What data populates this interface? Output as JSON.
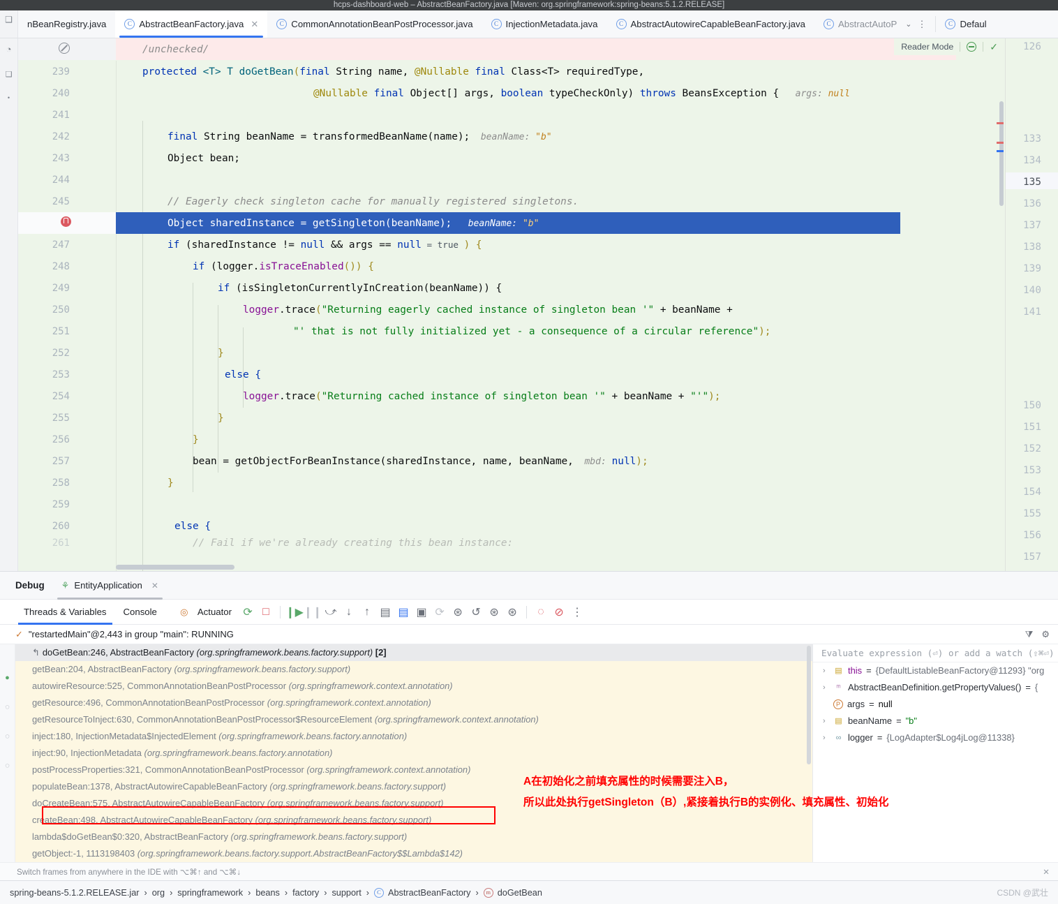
{
  "window": {
    "title": "hcps-dashboard-web – AbstractBeanFactory.java [Maven: org.springframework:spring-beans:5.1.2.RELEASE]"
  },
  "tabs": [
    {
      "label": "nBeanRegistry.java",
      "active": false,
      "icon": "class-icon"
    },
    {
      "label": "AbstractBeanFactory.java",
      "active": true,
      "icon": "class-icon"
    },
    {
      "label": "CommonAnnotationBeanPostProcessor.java",
      "active": false,
      "icon": "class-icon"
    },
    {
      "label": "InjectionMetadata.java",
      "active": false,
      "icon": "class-icon"
    },
    {
      "label": "AbstractAutowireCapableBeanFactory.java",
      "active": false,
      "icon": "class-icon"
    },
    {
      "label": "AbstractAutoP",
      "active": false,
      "icon": "class-icon"
    },
    {
      "label": "Defaul",
      "active": false,
      "icon": "class-icon"
    }
  ],
  "editor": {
    "reader_mode": "Reader Mode",
    "lines": [
      {
        "num": "",
        "gutter": "no-entry"
      },
      {
        "num": "239"
      },
      {
        "num": "240"
      },
      {
        "num": "241"
      },
      {
        "num": "242"
      },
      {
        "num": "243"
      },
      {
        "num": "244"
      },
      {
        "num": "245"
      },
      {
        "num": "246",
        "gutter": "breakpoint",
        "highlighted": true
      },
      {
        "num": "247"
      },
      {
        "num": "248"
      },
      {
        "num": "249"
      },
      {
        "num": "250"
      },
      {
        "num": "251"
      },
      {
        "num": "252"
      },
      {
        "num": "253"
      },
      {
        "num": "254"
      },
      {
        "num": "255"
      },
      {
        "num": "256"
      },
      {
        "num": "257"
      },
      {
        "num": "258"
      },
      {
        "num": "259"
      },
      {
        "num": "260"
      },
      {
        "num": "261"
      }
    ],
    "code": {
      "l238_unchecked": "/unchecked/",
      "l239_a": "protected ",
      "l239_b": "<T> T ",
      "l239_c": "doGetBean",
      "l239_d": "(",
      "l239_e": "final ",
      "l239_f": "String name, ",
      "l239_g": "@Nullable ",
      "l239_h": "final ",
      "l239_i": "Class<T> requiredType,",
      "l240_a": "@Nullable ",
      "l240_b": "final ",
      "l240_c": "Object[] args, ",
      "l240_d": "boolean ",
      "l240_e": "typeCheckOnly) ",
      "l240_f": "throws ",
      "l240_g": "BeansException {",
      "l240_hint": "args:",
      "l240_hintval": "null",
      "l242_a": "final ",
      "l242_b": "String beanName = transformedBeanName(name);",
      "l242_hint": "beanName:",
      "l242_hintval": "\"b\"",
      "l243": "Object bean;",
      "l245": "// Eagerly check singleton cache for manually registered singletons.",
      "l246": "Object sharedInstance = getSingleton(beanName);",
      "l246_hint": "beanName:",
      "l246_hintval": "\"b\"",
      "l247_a": "if ",
      "l247_b": "(sharedInstance != ",
      "l247_c": "null",
      "l247_d": " && args == ",
      "l247_e": "null",
      "l247_hint": "= true",
      "l247_f": ") {",
      "l248_a": "if ",
      "l248_b": "(logger.",
      "l248_c": "isTraceEnabled",
      "l248_d": "()) {",
      "l249_a": "if ",
      "l249_b": "(isSingletonCurrentlyInCreation(beanName)) {",
      "l250_a": "logger",
      "l250_b": ".trace",
      "l250_c": "(",
      "l250_d": "\"Returning eagerly cached instance of singleton bean '\"",
      "l250_e": " + beanName +",
      "l251_a": "\"' that is not fully initialized yet - a consequence of a circular reference\"",
      "l251_b": ");",
      "l252": "}",
      "l253": "else {",
      "l254_a": "logger",
      "l254_b": ".trace",
      "l254_c": "(",
      "l254_d": "\"Returning cached instance of singleton bean '\"",
      "l254_e": " + beanName + ",
      "l254_f": "\"'\"",
      "l254_g": ");",
      "l255": "}",
      "l256": "}",
      "l257_a": "bean = getObjectForBeanInstance(sharedInstance, name, beanName,",
      "l257_hint": "mbd:",
      "l257_hintval": "null",
      "l257_b": ");",
      "l258": "}",
      "l260": "else {",
      "l261": "// Fail if we're already creating this bean instance:"
    },
    "right_pane_lines": [
      "126",
      "133",
      "134",
      "135",
      "136",
      "137",
      "138",
      "139",
      "140",
      "141",
      "150",
      "151",
      "152",
      "153",
      "154",
      "155",
      "156",
      "157"
    ],
    "right_pane_current": "135"
  },
  "debug": {
    "panel_title": "Debug",
    "session_tab": "EntityApplication",
    "tabs": [
      {
        "label": "Threads & Variables",
        "selected": true
      },
      {
        "label": "Console",
        "selected": false
      }
    ],
    "actuator_label": "Actuator",
    "thread_status": "\"restartedMain\"@2,443 in group \"main\": RUNNING",
    "frames": [
      {
        "text": "doGetBean:246, AbstractBeanFactory ",
        "pkg": "(org.springframework.beans.factory.support)",
        "count": "[2]",
        "top": true
      },
      {
        "text": "getBean:204, AbstractBeanFactory ",
        "pkg": "(org.springframework.beans.factory.support)"
      },
      {
        "text": "autowireResource:525, CommonAnnotationBeanPostProcessor ",
        "pkg": "(org.springframework.context.annotation)"
      },
      {
        "text": "getResource:496, CommonAnnotationBeanPostProcessor ",
        "pkg": "(org.springframework.context.annotation)"
      },
      {
        "text": "getResourceToInject:630, CommonAnnotationBeanPostProcessor$ResourceElement ",
        "pkg": "(org.springframework.context.annotation)"
      },
      {
        "text": "inject:180, InjectionMetadata$InjectedElement ",
        "pkg": "(org.springframework.beans.factory.annotation)"
      },
      {
        "text": "inject:90, InjectionMetadata ",
        "pkg": "(org.springframework.beans.factory.annotation)"
      },
      {
        "text": "postProcessProperties:321, CommonAnnotationBeanPostProcessor ",
        "pkg": "(org.springframework.context.annotation)"
      },
      {
        "text": "populateBean:1378, AbstractAutowireCapableBeanFactory ",
        "pkg": "(org.springframework.beans.factory.support)",
        "boxed": true
      },
      {
        "text": "doCreateBean:575, AbstractAutowireCapableBeanFactory ",
        "pkg": "(org.springframework.beans.factory.support)"
      },
      {
        "text": "createBean:498, AbstractAutowireCapableBeanFactory ",
        "pkg": "(org.springframework.beans.factory.support)"
      },
      {
        "text": "lambda$doGetBean$0:320, AbstractBeanFactory ",
        "pkg": "(org.springframework.beans.factory.support)"
      },
      {
        "text": "getObject:-1, 1113198403 ",
        "pkg": "(org.springframework.beans.factory.support.AbstractBeanFactory$$Lambda$142)"
      }
    ],
    "evaluate_placeholder": "Evaluate expression (⏎) or add a watch (⇧⌘⏎)",
    "variables": [
      {
        "expandable": true,
        "icon": "list-icon",
        "name": "this",
        "eq": " = ",
        "value": "{DefaultListableBeanFactory@11293} \"org",
        "kind": "ref"
      },
      {
        "expandable": true,
        "icon": "method-icon",
        "name": "AbstractBeanDefinition.getPropertyValues()",
        "eq": " = ",
        "value": "{",
        "kind": "ref"
      },
      {
        "expandable": false,
        "icon": "param-icon",
        "name": "args",
        "eq": " = ",
        "value": "null",
        "kind": "null"
      },
      {
        "expandable": true,
        "icon": "list-icon",
        "name": "beanName",
        "eq": " = ",
        "value": "\"b\"",
        "kind": "string"
      },
      {
        "expandable": true,
        "icon": "infinity-icon",
        "name": "logger",
        "eq": " = ",
        "value": "{LogAdapter$Log4jLog@11338}",
        "kind": "ref"
      }
    ],
    "switch_hint": "Switch frames from anywhere in the IDE with ⌥⌘↑ and ⌥⌘↓"
  },
  "annotation": {
    "line1": "A在初始化之前填充属性的时候需要注入B，",
    "line2": "所以此处执行getSingleton（B）,紧接着执行B的实例化、填充属性、初始化"
  },
  "statusbar": {
    "crumbs": [
      "spring-beans-5.1.2.RELEASE.jar",
      "org",
      "springframework",
      "beans",
      "factory",
      "support",
      "AbstractBeanFactory",
      "doGetBean"
    ],
    "watermark": "CSDN @武壮"
  },
  "colors": {
    "accent": "#3574f0",
    "debug_highlight": "#2f5fbb",
    "editor_bg": "#edf5e9",
    "frames_bg": "#fdf7e2",
    "annotation_red": "#ff0000",
    "keyword": "#0033b3",
    "string": "#067d17",
    "comment": "#8c8c8c"
  }
}
